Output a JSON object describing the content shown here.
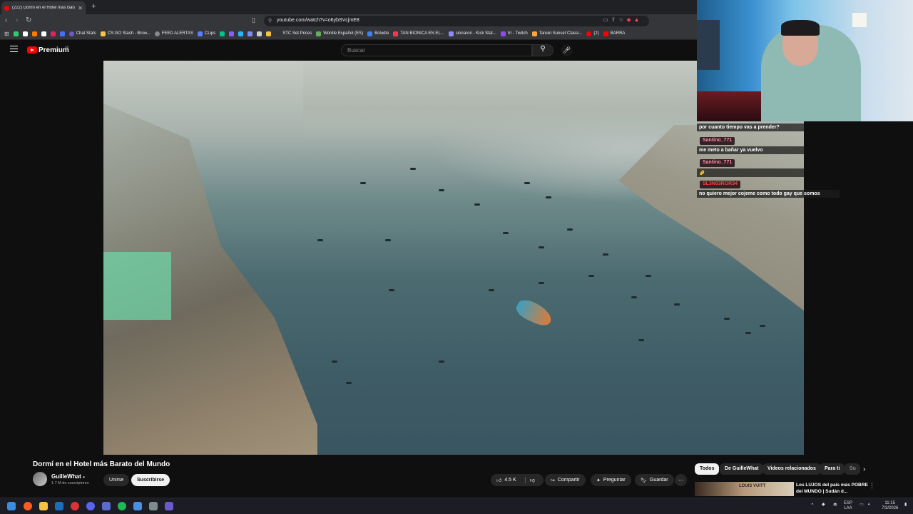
{
  "browser": {
    "tab_title": "(222) Dormí en el Hotel más Barato del Mundo",
    "url": "youtube.com/watch?v=o6ybSVcjmE8",
    "bookmarks": [
      {
        "label": "Chat Stats",
        "color": "#6a5acd"
      },
      {
        "label": "CS:GO Stash - Brow...",
        "color": "#f5c242"
      },
      {
        "label": "FEED ALERTAS",
        "color": "#888888"
      },
      {
        "label": "CLips",
        "color": "#5a7dff"
      },
      {
        "label": "STC Set Prices",
        "color": "#222222"
      },
      {
        "label": "Wordle Español (ES)",
        "color": "#6aaa64"
      },
      {
        "label": "Boludle",
        "color": "#3b82f6"
      },
      {
        "label": "TAN BIONICA EN EL...",
        "color": "#ff3355"
      },
      {
        "label": "sionaron - Kick Stat...",
        "color": "#8a8aff"
      },
      {
        "label": "trr - Twitch",
        "color": "#9146ff"
      },
      {
        "label": "Tanuki Sunset Classi...",
        "color": "#f5a742"
      },
      {
        "label": "(2)",
        "color": "#ff0000"
      },
      {
        "label": "BARRA",
        "color": "#ff0000"
      }
    ]
  },
  "youtube": {
    "brand": "Premium",
    "country": "AR",
    "search_placeholder": "Buscar",
    "video_title": "Dormí en el Hotel más Barato del Mundo",
    "channel": {
      "name": "GuilleWhat",
      "subscribers": "1.7 M de suscriptores"
    },
    "buttons": {
      "join": "Unirse",
      "subscribe": "Suscribirse",
      "likes": "4.5 K",
      "share": "Compartir",
      "ask": "Preguntar",
      "save": "Guardar"
    },
    "chips": [
      "Todos",
      "De GuilleWhat",
      "Videos relacionados",
      "Para ti",
      "Su"
    ],
    "recommended": {
      "title": "Los LUJOS del país más POBRE del MUNDO | Sudán d...",
      "thumb_text": "LOUIS VUITT"
    }
  },
  "chat": {
    "messages": [
      {
        "user": "",
        "text": "por cuanto tiempo vas a prender?"
      },
      {
        "user": "Santino_771",
        "text": "me meto a bañar ya vuelvo"
      },
      {
        "user": "Santino_771",
        "text": "🤌"
      },
      {
        "user": "SL3N03RGR34",
        "text": "no quiero mejor cojeme como todo gay que somos"
      }
    ]
  },
  "taskbar": {
    "lang": "ESP",
    "lang2": "LAA",
    "time": "11:15",
    "date": "7/3/2026"
  }
}
